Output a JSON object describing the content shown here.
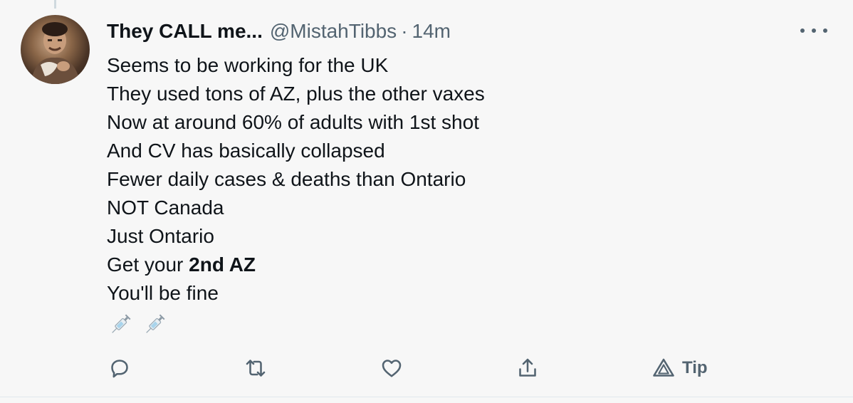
{
  "tweet": {
    "display_name": "They CALL me...",
    "handle": "@MistahTibbs",
    "separator": "·",
    "time": "14m",
    "lines": [
      "Seems to be working for the UK",
      "They used tons of AZ, plus the other vaxes",
      "Now at around 60% of adults with 1st shot",
      "And CV has basically collapsed",
      "Fewer daily cases & deaths than Ontario",
      "NOT Canada",
      "Just Ontario"
    ],
    "get_your_prefix": "Get your ",
    "get_your_bold": "2nd AZ",
    "last_line": "You'll be fine",
    "emojis": [
      "syringe-emoji",
      "syringe-emoji"
    ]
  },
  "actions": {
    "reply_icon": "reply-icon",
    "retweet_icon": "retweet-icon",
    "like_icon": "heart-icon",
    "share_icon": "share-icon",
    "tip_icon": "tip-icon",
    "tip_label": "Tip"
  },
  "colors": {
    "background": "#f7f7f7",
    "text": "#0f1419",
    "secondary": "#536471"
  }
}
